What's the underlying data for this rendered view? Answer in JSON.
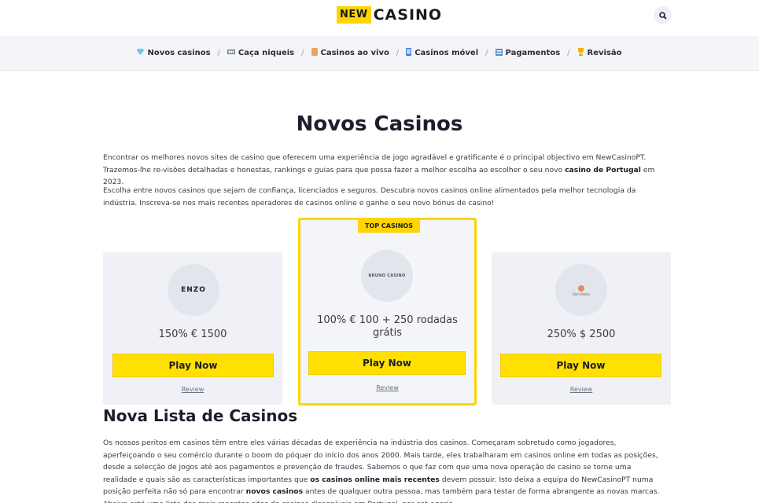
{
  "header": {
    "logo_new": "NEW",
    "logo_casino": "CASINO",
    "search_icon": "search-icon"
  },
  "nav": {
    "items": [
      {
        "label": "Novos casinos",
        "icon": "diamond-icon"
      },
      {
        "label": "Caça niqueis",
        "icon": "slot-icon"
      },
      {
        "label": "Casinos ao vivo",
        "icon": "live-icon"
      },
      {
        "label": "Casinos móvel",
        "icon": "mobile-icon"
      },
      {
        "label": "Pagamentos",
        "icon": "payment-icon"
      },
      {
        "label": "Revisão",
        "icon": "trophy-icon"
      }
    ],
    "separator": "/"
  },
  "main": {
    "title": "Novos Casinos",
    "intro_1_a": "Encontrar os melhores novos sites de casino que oferecem uma experiência de jogo agradável e gratificante é o principal objectivo em NewCasinoPT. Trazemos-lhe re-visões detalhadas e honestas, rankings e guias para que possa fazer a melhor escolha ao escolher o seu novo ",
    "intro_1_bold": "casino de Portugal",
    "intro_1_b": " em 2023.",
    "intro_2": "Escolha entre novos casinos que sejam de confiança, licenciados e seguros. Descubra novos casinos online alimentados pela melhor tecnologia da indústria. Inscreva-se nos mais recentes operadores de casinos online e ganhe o seu novo bónus de casino!"
  },
  "cards": [
    {
      "logo_text": "ENZO",
      "bonus": "150% € 1500",
      "cta": "Play Now",
      "review": "Review"
    },
    {
      "badge": "TOP CASINOS",
      "logo_text": "BRUNO CASINO",
      "bonus": "100% € 100 + 250 rodadas grátis",
      "cta": "Play Now",
      "review": "Review"
    },
    {
      "logo_text": "Rich Palms",
      "bonus": "250% $ 2500",
      "cta": "Play Now",
      "review": "Review"
    }
  ],
  "section": {
    "title": "Nova Lista de Casinos",
    "body_a": "Os nossos peritos em casinos têm entre eles várias décadas de experiência na indústria dos casinos. Começaram sobretudo como jogadores, aperfeiçoando o seu comércio durante o boom do póquer do início dos anos 2000. Mais tarde, eles trabalharam em casinos online em todas as posições, desde a selecção de jogos até aos pagamentos e prevenção de fraudes. Sabemos o que faz com que uma nova operação de casino se torne uma realidade e quais são as características importantes que ",
    "body_bold_1": "os casinos online mais recentes",
    "body_b": " devem possuir. Isto deixa a equipa do NewCasinoPT numa posição perfeita não só para encontrar ",
    "body_bold_2": "novos casinos",
    "body_c": " antes de qualquer outra pessoa, mas também para testar de forma abrangente as novas marcas. Abaixo está uma lista dos mais recentes sites de casinos disponíveis em Portugal, por cat-egoria."
  },
  "colors": {
    "accent": "#ffd400",
    "nav_bg": "#f4f5f9",
    "card_bg": "#f0f1f6",
    "text": "#1d1d2b"
  }
}
